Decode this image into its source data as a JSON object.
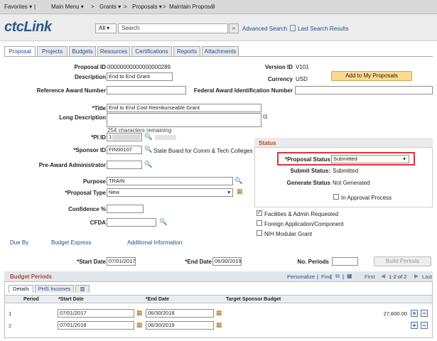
{
  "nav": {
    "favorites": "Favorites ▾",
    "main_menu": "Main Menu ▾",
    "grants": "Grants ▾",
    "proposals": "Proposals ▾",
    "current": "Maintain Proposal"
  },
  "header": {
    "logo": "ctcLink",
    "search_scope": "All ▾",
    "search_value": "Search",
    "advanced_search": "Advanced Search",
    "last_search": "Last Search Results"
  },
  "tabs": [
    "Proposal",
    "Projects",
    "Budgets",
    "Resources",
    "Certifications",
    "Reports",
    "Attachments"
  ],
  "proposal": {
    "proposal_id_label": "Proposal ID",
    "proposal_id": "00000000000000000289",
    "description_label": "Description",
    "description": "End to End Grant",
    "reference_award_label": "Reference Award Number",
    "reference_award": "",
    "version_id_label": "Version ID",
    "version_id": "V101",
    "currency_label": "Currency",
    "currency": "USD",
    "add_button": "Add to My Proposals",
    "federal_award_label": "Federal Award Identification Number",
    "federal_award": "",
    "title_label": "*Title",
    "title": "End to End Cost Reimburseable Grant",
    "long_desc_label": "Long Description",
    "chars_remaining": "254 characters remaining",
    "pi_label": "*PI ID",
    "pi_id": "1",
    "sponsor_label": "*Sponsor ID",
    "sponsor_id": "FIN00107",
    "sponsor_name": "State Board for Comm & Tech Colleges",
    "pre_award_label": "Pre-Award Administrator",
    "pre_award": "",
    "purpose_label": "Purpose",
    "purpose": "TRAIN",
    "proposal_type_label": "*Proposal Type",
    "proposal_type": "New",
    "confidence_label": "Confidence %",
    "confidence": "",
    "cfda_label": "CFDA",
    "cfda": ""
  },
  "status": {
    "header": "Status",
    "proposal_status_label": "*Proposal Status",
    "proposal_status": "Submitted",
    "submit_status_label": "Submit Status:",
    "submit_status": "Submitted",
    "generate_status_label": "Generate Status",
    "generate_status": "Not Generated",
    "in_approval": "In Approval Process"
  },
  "checks": {
    "fa_requested": "Facilities & Admin Requested",
    "foreign_app": "Foreign Application/Component",
    "nih_modular": "NIH Modular Grant"
  },
  "links": {
    "due_by": "Due By",
    "budget_express": "Budget Express",
    "additional_info": "Additional Information"
  },
  "dates": {
    "start_label": "*Start Date",
    "start": "07/01/2017",
    "end_label": "*End Date",
    "end": "06/30/2019",
    "periods_label": "No. Periods",
    "periods": "",
    "build_periods": "Build Periods"
  },
  "budget_periods": {
    "title": "Budget Periods",
    "personalize": "Personalize",
    "find": "Find",
    "first": "First",
    "range": "1-2 of 2",
    "last": "Last",
    "tab_details": "Details",
    "tab_phs": "PHS Incomes",
    "columns": [
      "Period",
      "*Start Date",
      "*End Date",
      "Target Sponsor Budget"
    ],
    "rows": [
      {
        "period": "1",
        "start": "07/01/2017",
        "end": "06/30/2018",
        "budget": "27,600.00"
      },
      {
        "period": "2",
        "start": "07/01/2018",
        "end": "06/30/2019",
        "budget": ""
      }
    ]
  }
}
